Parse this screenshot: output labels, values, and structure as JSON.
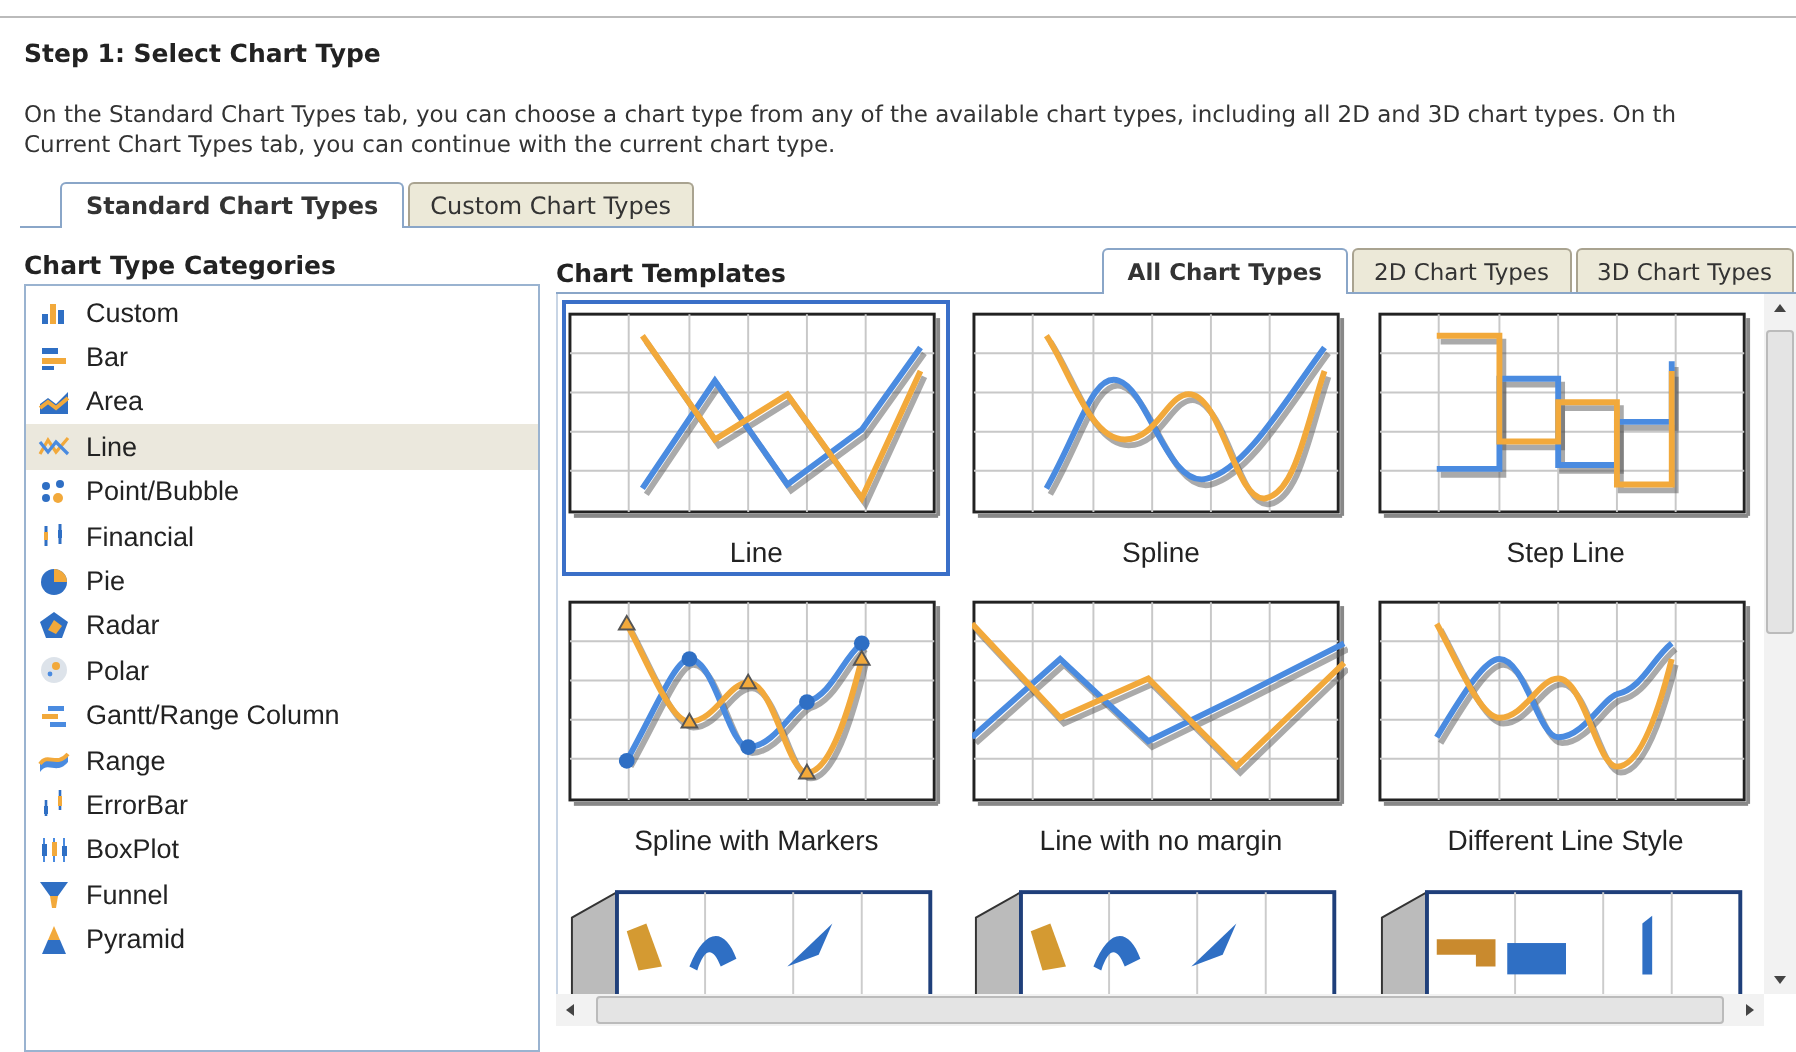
{
  "heading": "Step 1: Select Chart Type",
  "description": "On the Standard Chart Types tab, you can choose a chart type from any of the available chart types, including all 2D and 3D chart types. On th\nCurrent Chart Types tab, you can continue with the current chart type.",
  "main_tabs": [
    {
      "label": "Standard Chart Types",
      "selected": true
    },
    {
      "label": "Custom Chart Types",
      "selected": false
    }
  ],
  "categories": {
    "title": "Chart Type Categories",
    "items": [
      {
        "label": "Custom",
        "kind": "custom",
        "selected": false
      },
      {
        "label": "Bar",
        "kind": "bar",
        "selected": false
      },
      {
        "label": "Area",
        "kind": "area",
        "selected": false
      },
      {
        "label": "Line",
        "kind": "line",
        "selected": true
      },
      {
        "label": "Point/Bubble",
        "kind": "point",
        "selected": false
      },
      {
        "label": "Financial",
        "kind": "financial",
        "selected": false
      },
      {
        "label": "Pie",
        "kind": "pie",
        "selected": false
      },
      {
        "label": "Radar",
        "kind": "radar",
        "selected": false
      },
      {
        "label": "Polar",
        "kind": "polar",
        "selected": false
      },
      {
        "label": "Gantt/Range Column",
        "kind": "gantt",
        "selected": false
      },
      {
        "label": "Range",
        "kind": "range",
        "selected": false
      },
      {
        "label": "ErrorBar",
        "kind": "errorbar",
        "selected": false
      },
      {
        "label": "BoxPlot",
        "kind": "boxplot",
        "selected": false
      },
      {
        "label": "Funnel",
        "kind": "funnel",
        "selected": false
      },
      {
        "label": "Pyramid",
        "kind": "pyramid",
        "selected": false
      }
    ]
  },
  "templates": {
    "title": "Chart Templates",
    "tabs": [
      {
        "label": "All Chart Types",
        "selected": true
      },
      {
        "label": "2D Chart Types",
        "selected": false
      },
      {
        "label": "3D Chart Types",
        "selected": false
      }
    ],
    "items": [
      {
        "label": "Line",
        "kind": "line",
        "selected": true
      },
      {
        "label": "Spline",
        "kind": "spline",
        "selected": false
      },
      {
        "label": "Step Line",
        "kind": "step",
        "selected": false
      },
      {
        "label": "Spline with Markers",
        "kind": "markers",
        "selected": false
      },
      {
        "label": "Line with no margin",
        "kind": "nomargin",
        "selected": false
      },
      {
        "label": "Different Line Style",
        "kind": "style",
        "selected": false
      },
      {
        "kind": "ribbon3d",
        "selected": false
      },
      {
        "kind": "ribbon3d",
        "selected": false
      },
      {
        "kind": "step3d",
        "selected": false
      }
    ]
  }
}
